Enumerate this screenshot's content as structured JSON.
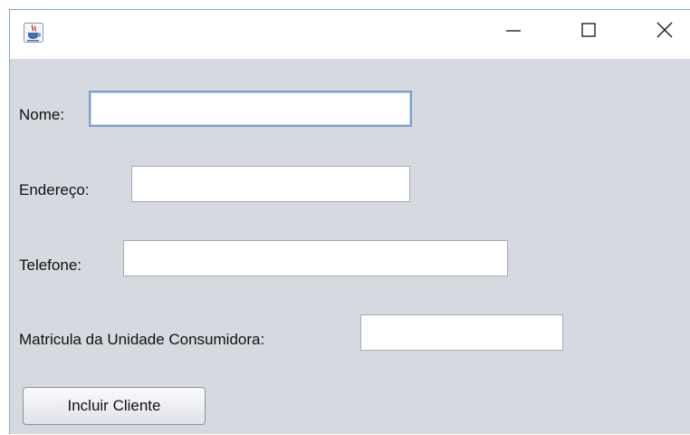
{
  "window": {
    "controls": {
      "minimize_glyph": "—",
      "maximize_icon": "maximize-icon",
      "close_icon": "close-icon"
    },
    "app_icon": "java-cup-icon"
  },
  "form": {
    "nome": {
      "label": "Nome:",
      "value": ""
    },
    "endereco": {
      "label": "Endereço:",
      "value": ""
    },
    "telefone": {
      "label": "Telefone:",
      "value": ""
    },
    "matricula": {
      "label": "Matricula da Unidade Consumidora:",
      "value": ""
    },
    "submit_label": "Incluir Cliente"
  },
  "colors": {
    "panel_bg": "#d6d9df",
    "titlebar_bg": "#ffffff",
    "focus_border": "#7e9fc9"
  }
}
